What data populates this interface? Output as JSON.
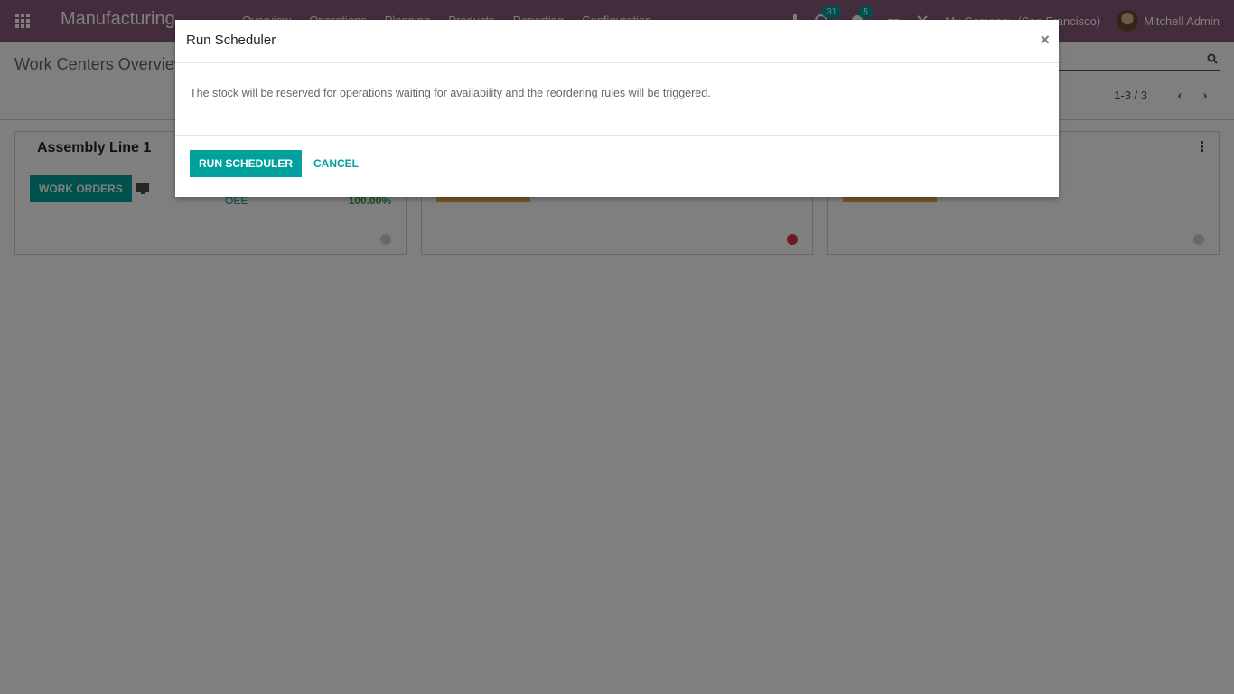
{
  "navbar": {
    "app_name": "Manufacturing",
    "menu": [
      "Overview",
      "Operations",
      "Planning",
      "Products",
      "Reporting",
      "Configuration"
    ],
    "activity_count": "31",
    "message_count": "5",
    "company": "My Company (San Francisco)",
    "user": "Mitchell Admin",
    "brand_color": "#875a7b"
  },
  "control_panel": {
    "title": "Work Centers Overview",
    "pager": "1-3 / 3"
  },
  "cards": [
    {
      "title": "Assembly Line 1",
      "button": "WORK ORDERS",
      "oee_label": "OEE",
      "oee_value": "100.00%",
      "status": "gray"
    },
    {
      "status": "red"
    },
    {
      "status": "gray"
    }
  ],
  "modal": {
    "title": "Run Scheduler",
    "close": "×",
    "body": "The stock will be reserved for operations waiting for availability and the reordering rules will be triggered.",
    "primary_button": "RUN SCHEDULER",
    "cancel_button": "CANCEL",
    "accent_color": "#00a09d"
  }
}
